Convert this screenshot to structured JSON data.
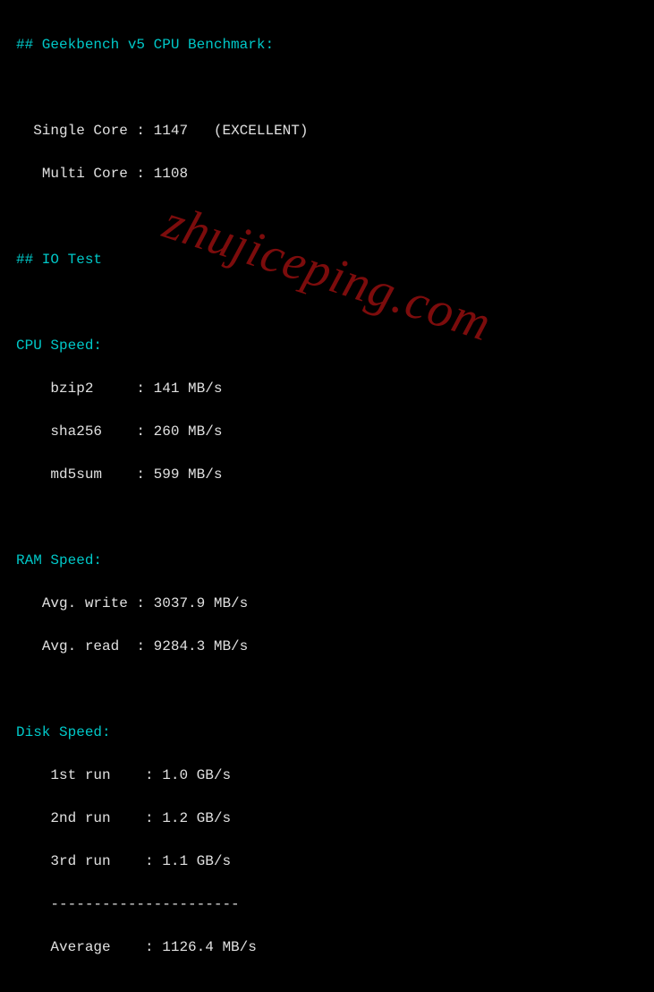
{
  "watermark": "zhujiceping.com",
  "sections": {
    "geekbench_header": "## Geekbench v5 CPU Benchmark:",
    "io_header": "## IO Test",
    "cpu_speed_header": "CPU Speed:",
    "ram_speed_header": "RAM Speed:",
    "disk_speed_header": "Disk Speed:"
  },
  "geekbench": {
    "single_label": "Single Core",
    "single_value": "1147",
    "single_note": "(EXCELLENT)",
    "multi_label": "Multi Core",
    "multi_value": "1108"
  },
  "cpu_speed": [
    {
      "name": "bzip2",
      "value": "141 MB/s"
    },
    {
      "name": "sha256",
      "value": "260 MB/s"
    },
    {
      "name": "md5sum",
      "value": "599 MB/s"
    }
  ],
  "ram_speed": {
    "write_label": "Avg. write",
    "write_value": "3037.9 MB/s",
    "read_label": "Avg. read",
    "read_value": "9284.3 MB/s"
  },
  "disk_speed": {
    "runs": [
      {
        "name": "1st run",
        "value": "1.0 GB/s"
      },
      {
        "name": "2nd run",
        "value": "1.2 GB/s"
      },
      {
        "name": "3rd run",
        "value": "1.1 GB/s"
      }
    ],
    "divider": "----------------------",
    "avg_label": "Average",
    "avg_value": "1126.4 MB/s"
  }
}
